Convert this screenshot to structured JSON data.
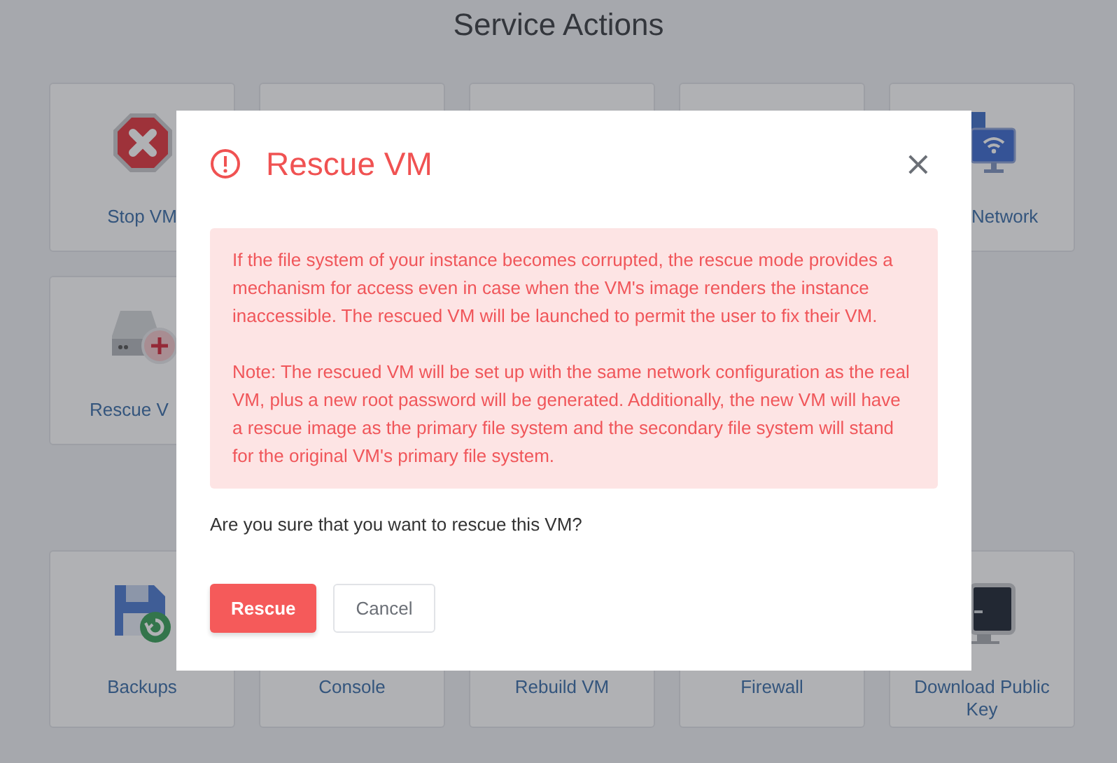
{
  "page": {
    "title": "Service Actions"
  },
  "action_rows": [
    [
      {
        "label": "Stop VM"
      },
      {},
      {},
      {},
      {
        "label": "Network"
      }
    ],
    [
      {
        "label": "Rescue V"
      }
    ],
    [
      {
        "label": "Backups"
      },
      {
        "label": "Console"
      },
      {
        "label": "Rebuild VM"
      },
      {
        "label": "Firewall"
      },
      {
        "label": "Download Public Key"
      }
    ]
  ],
  "dialog": {
    "title": "Rescue VM",
    "close": "×",
    "alert": [
      "If the file system of your instance becomes corrupted, the rescue mode provides a mechanism for access even in case when the VM's image renders the instance inaccessible. The rescued VM will be launched to permit the user to fix their VM.",
      "Note: The rescued VM will be set up with the same network configuration as the real VM, plus a new root password will be generated. Additionally, the new VM will have a rescue image as the primary file system and the secondary file system will stand for the original VM's primary file system."
    ],
    "question": "Are you sure that you want to rescue this VM?",
    "buttons": [
      {
        "label": "Rescue",
        "kind": "primary"
      },
      {
        "label": "Cancel",
        "kind": "secondary"
      }
    ]
  }
}
